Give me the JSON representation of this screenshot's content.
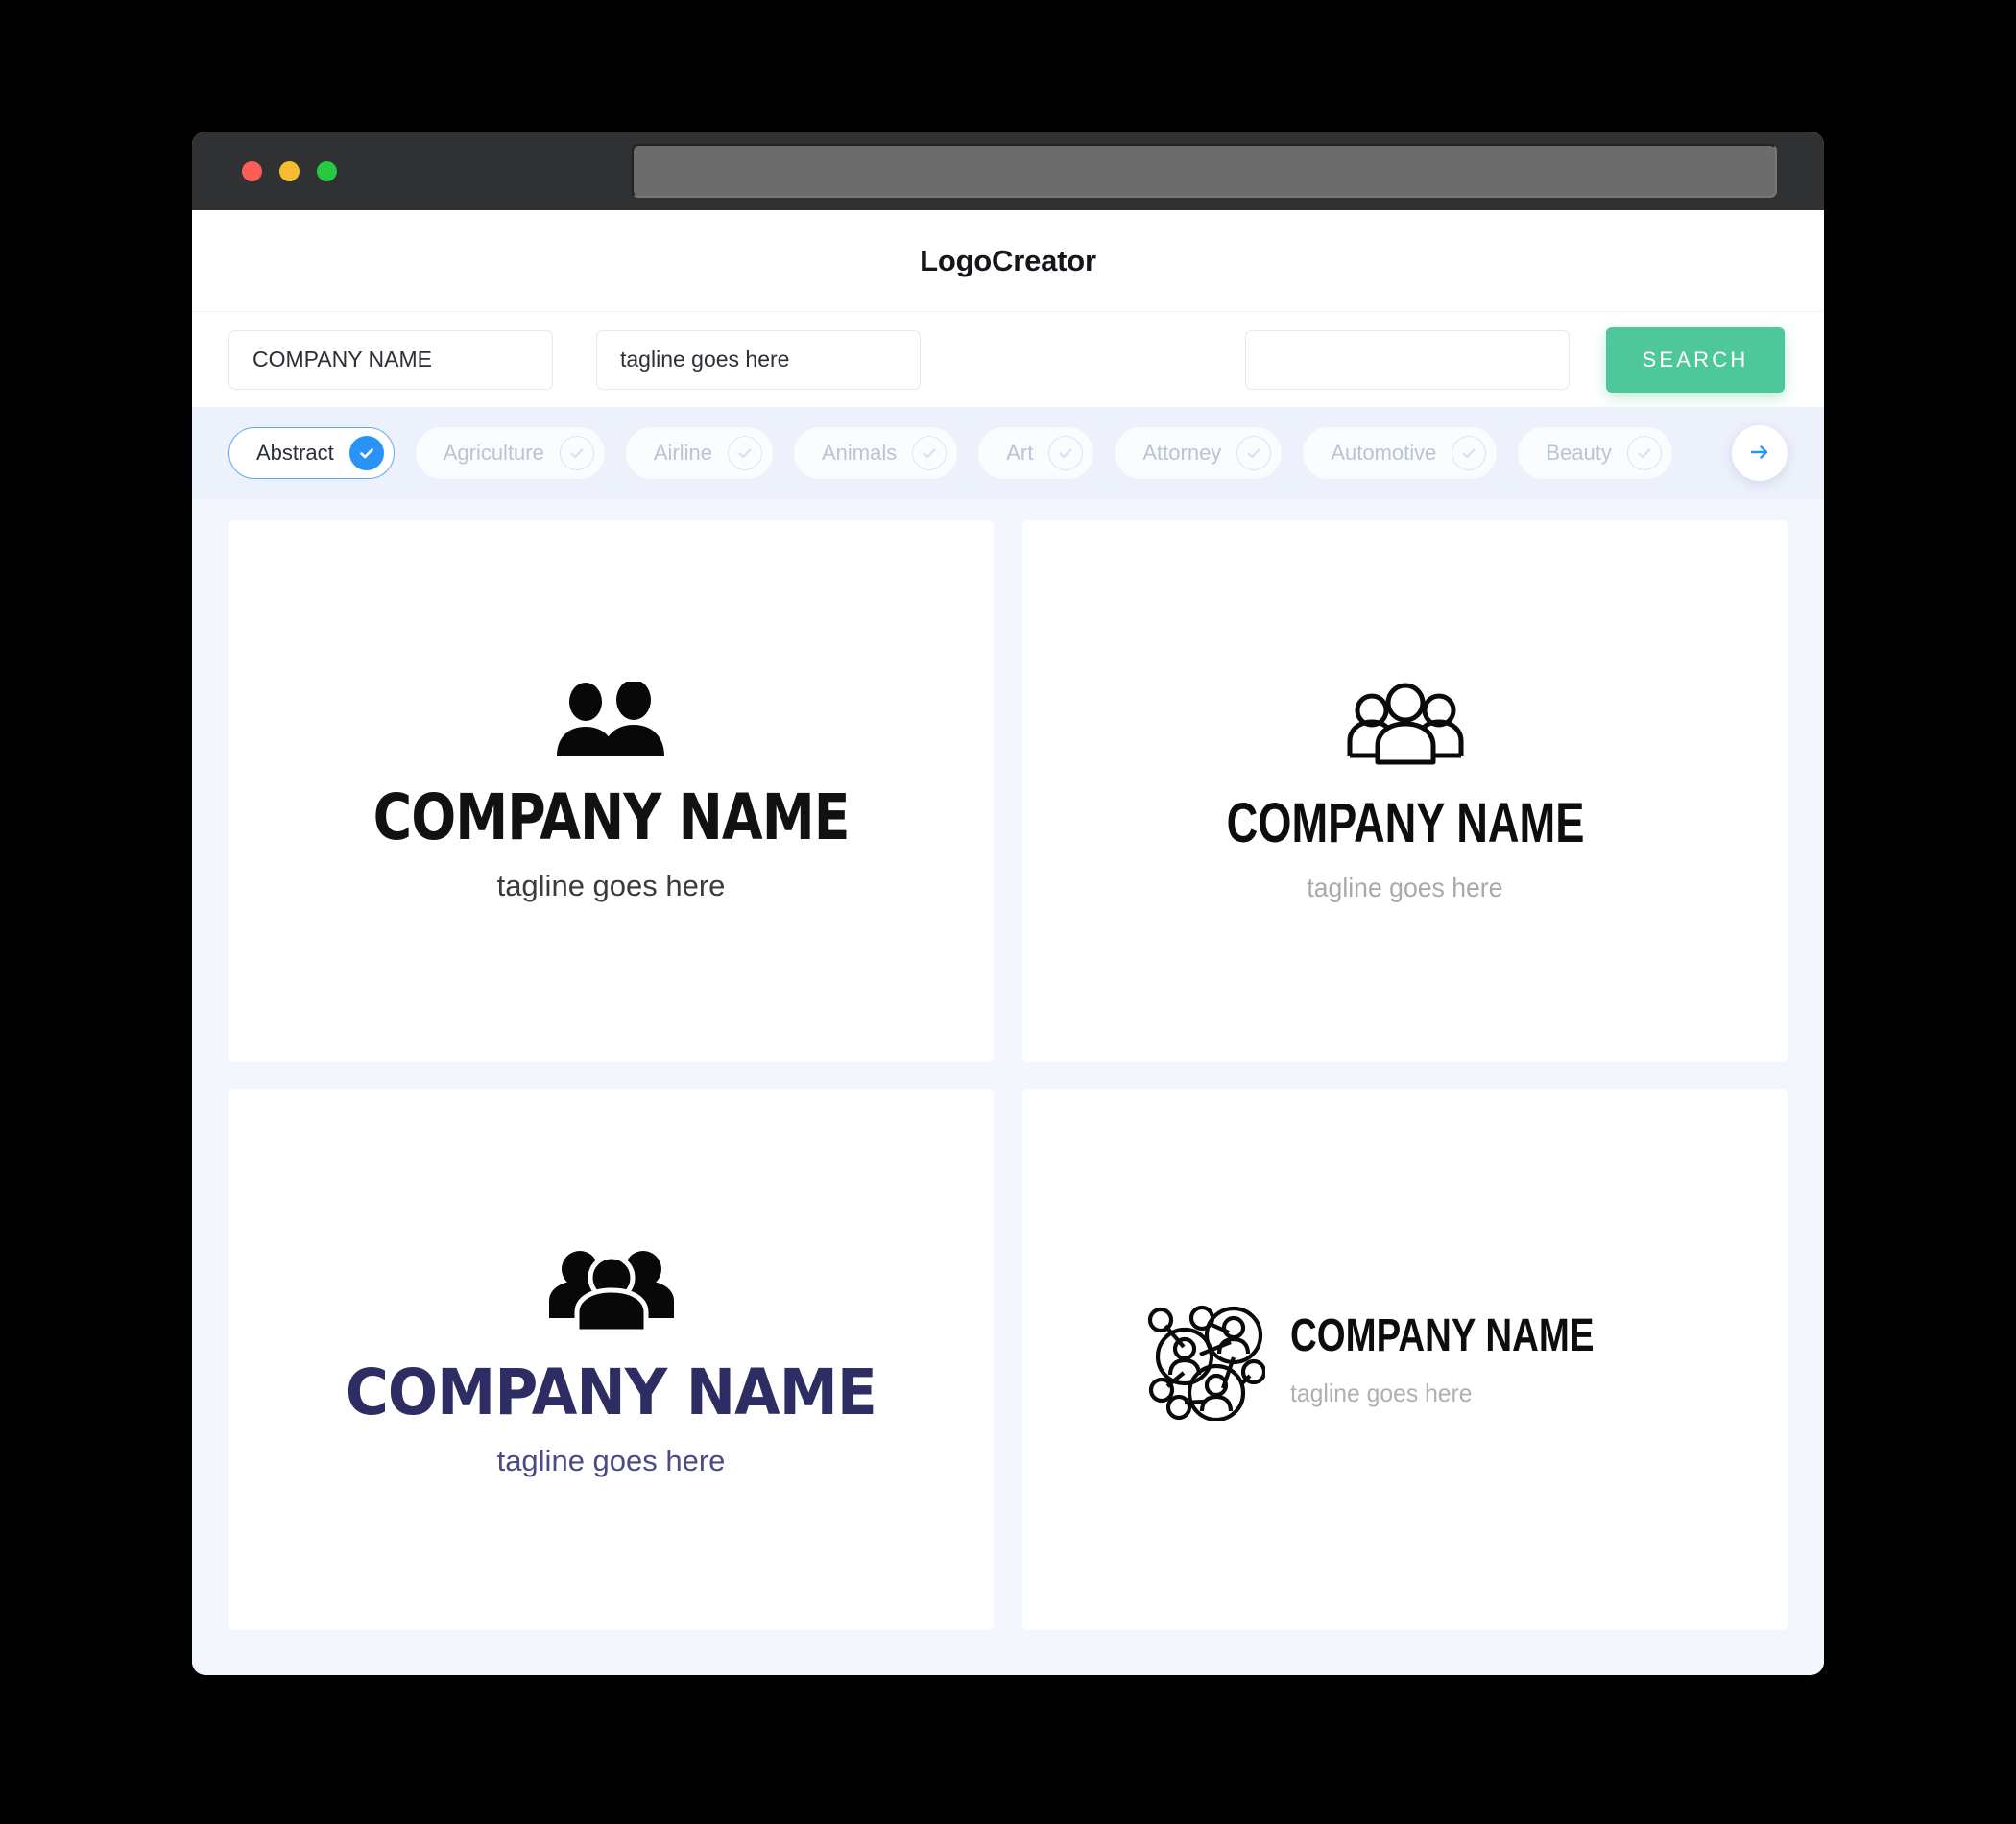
{
  "window": {
    "traffic_lights": [
      {
        "name": "close",
        "color": "#fa5e57"
      },
      {
        "name": "minimize",
        "color": "#f6bc2f"
      },
      {
        "name": "maximize",
        "color": "#28c840"
      }
    ],
    "url_bar_value": ""
  },
  "header": {
    "app_title": "LogoCreator"
  },
  "search": {
    "company_name_value": "COMPANY NAME",
    "company_name_placeholder": "COMPANY NAME",
    "tagline_value": "tagline goes here",
    "tagline_placeholder": "tagline goes here",
    "keyword_value": "",
    "keyword_placeholder": "",
    "search_button_label": "SEARCH",
    "search_button_color": "#4ec79a"
  },
  "categories": {
    "accent_color": "#2a93f7",
    "next_arrow_icon": "arrow-right-icon",
    "items": [
      {
        "label": "Abstract",
        "selected": true
      },
      {
        "label": "Agriculture",
        "selected": false
      },
      {
        "label": "Airline",
        "selected": false
      },
      {
        "label": "Animals",
        "selected": false
      },
      {
        "label": "Art",
        "selected": false
      },
      {
        "label": "Attorney",
        "selected": false
      },
      {
        "label": "Automotive",
        "selected": false
      },
      {
        "label": "Beauty",
        "selected": false
      }
    ]
  },
  "results": {
    "cards": [
      {
        "id": "card-1",
        "icon": "two-people-solid-icon",
        "layout": "vertical",
        "name": "COMPANY NAME",
        "tagline": "tagline goes here",
        "name_color": "#111111",
        "tagline_color": "#3b3b3b"
      },
      {
        "id": "card-2",
        "icon": "group-of-three-outline-icon",
        "layout": "vertical",
        "name": "COMPANY NAME",
        "tagline": "tagline goes here",
        "name_color": "#0d0d0d",
        "tagline_color": "#a9a9a9"
      },
      {
        "id": "card-3",
        "icon": "group-of-three-solid-icon",
        "layout": "vertical",
        "name": "COMPANY NAME",
        "tagline": "tagline goes here",
        "name_color": "#2d2d63",
        "tagline_color": "#4a4a86"
      },
      {
        "id": "card-4",
        "icon": "people-network-icon",
        "layout": "horizontal",
        "name": "COMPANY NAME",
        "tagline": "tagline goes here",
        "name_color": "#0d0d0d",
        "tagline_color": "#b0b0b0"
      }
    ]
  }
}
